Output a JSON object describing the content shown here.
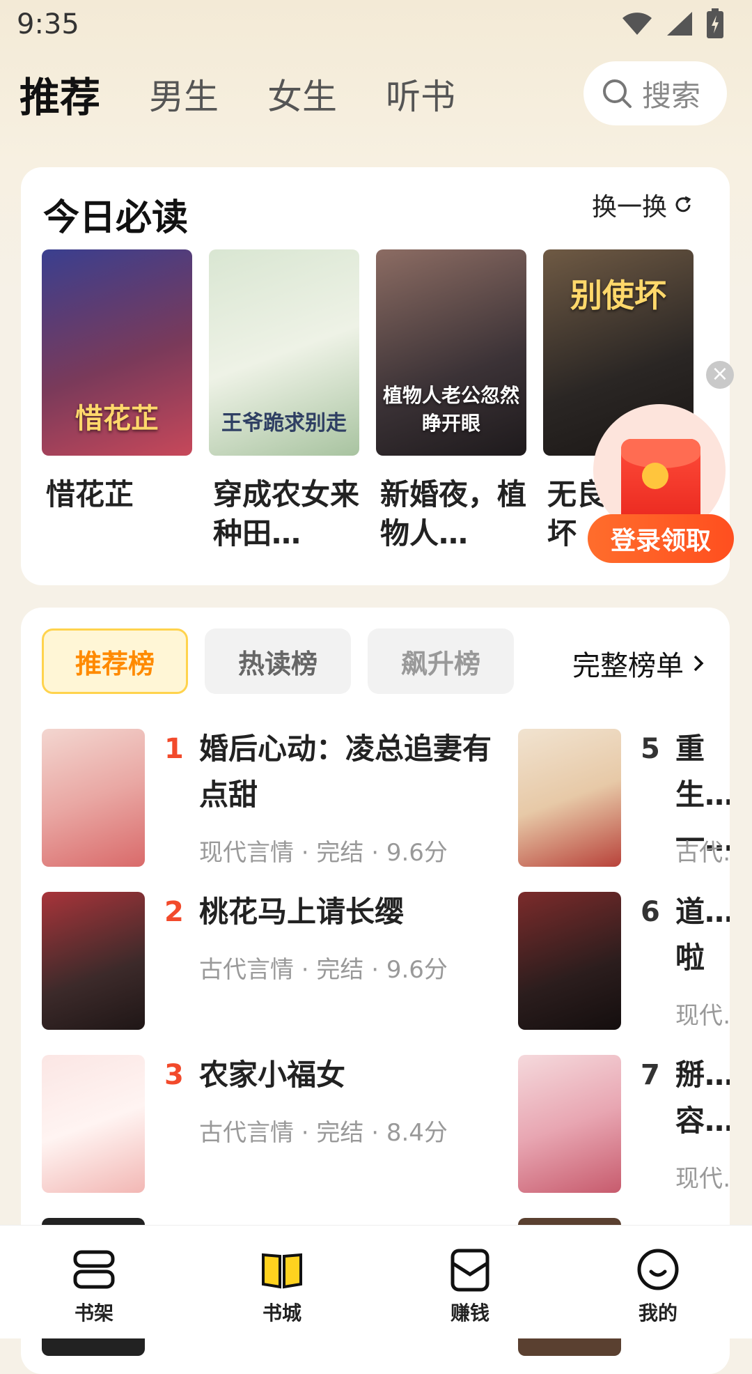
{
  "status_bar": {
    "time": "9:35"
  },
  "top_tabs": [
    {
      "label": "推荐",
      "active": true
    },
    {
      "label": "男生"
    },
    {
      "label": "女生"
    },
    {
      "label": "听书"
    }
  ],
  "search": {
    "placeholder": "搜索"
  },
  "must_read": {
    "title": "今日必读",
    "refresh_label": "换一换",
    "books": [
      {
        "name": "惜花芷",
        "cover_text": "惜花芷",
        "colors": [
          "#3a3f8f",
          "#c7485a"
        ]
      },
      {
        "name": "穿成农女来种田…",
        "cover_text": "王爷跪求别走",
        "colors": [
          "#d9e6d2",
          "#a8c3a0"
        ]
      },
      {
        "name": "新婚夜，植物人…",
        "cover_text": "植物人老公忽然睁开眼",
        "colors": [
          "#3b3236",
          "#8c6c63"
        ]
      },
      {
        "name": "无良…别使坏",
        "cover_text": "别使坏",
        "colors": [
          "#2a2624",
          "#6f5a44"
        ]
      }
    ]
  },
  "promo": {
    "button_label": "登录领取"
  },
  "rankings": {
    "tabs": [
      {
        "label": "推荐榜",
        "active": true
      },
      {
        "label": "热读榜"
      },
      {
        "label": "飙升榜"
      }
    ],
    "full_list_label": "完整榜单",
    "items_left": [
      {
        "rank": "1",
        "title": "婚后心动：凌总追妻有点甜",
        "meta": "现代言情 · 完结 · 9.6分",
        "colors": [
          "#f3d6d0",
          "#d96a6a"
        ]
      },
      {
        "rank": "2",
        "title": "桃花马上请长缨",
        "meta": "古代言情 · 完结 · 9.6分",
        "colors": [
          "#3c2a2a",
          "#a8343a"
        ]
      },
      {
        "rank": "3",
        "title": "农家小福女",
        "meta": "古代言情 · 完结 · 8.4分",
        "colors": [
          "#fbe6e4",
          "#f2b7b4"
        ]
      }
    ],
    "items_right": [
      {
        "rank": "5",
        "title": "重生…一…",
        "meta": "古代…",
        "colors": [
          "#f1e3d0",
          "#b8423a"
        ]
      },
      {
        "rank": "6",
        "title": "道…啦",
        "meta": "现代…",
        "colors": [
          "#2b1d1d",
          "#7c2b2b"
        ]
      },
      {
        "rank": "7",
        "title": "掰…容…",
        "meta": "现代…",
        "colors": [
          "#f5d9dc",
          "#c75b6d"
        ]
      }
    ]
  },
  "bottom_nav": [
    {
      "label": "书架",
      "icon": "bookshelf-icon"
    },
    {
      "label": "书城",
      "icon": "book-open-icon",
      "active": true
    },
    {
      "label": "赚钱",
      "icon": "wallet-icon"
    },
    {
      "label": "我的",
      "icon": "profile-icon"
    }
  ]
}
